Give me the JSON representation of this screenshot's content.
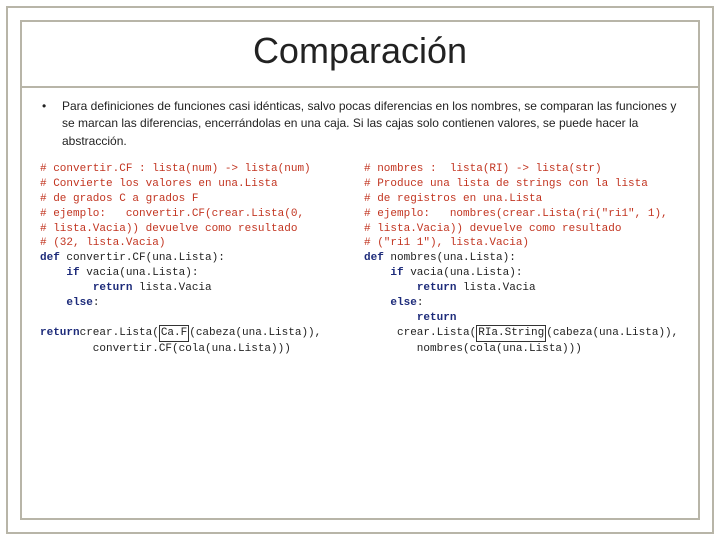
{
  "title": "Comparación",
  "bullet": "•",
  "paragraph": "Para definiciones de funciones  casi idénticas, salvo pocas diferencias en los nombres, se comparan las funciones y se marcan las diferencias, encerrándolas en una caja. Si las cajas solo contienen valores, se puede hacer la abstracción.",
  "code_left": {
    "c1": "# convertir.CF : lista(num) -> lista(num)",
    "c2": "# Convierte los valores en una.Lista",
    "c3": "# de grados C a grados F",
    "c4": "# ejemplo:   convertir.CF(crear.Lista(0,",
    "c5": "# lista.Vacia)) devuelve como resultado",
    "c6": "# (32, lista.Vacia)",
    "def_kw": "def",
    "def_rest": " convertir.CF(una.Lista):",
    "if_kw": "if",
    "if_rest": " vacia(una.Lista):",
    "ret_kw": "return",
    "ret_rest": " lista.Vacia",
    "else_kw": "else",
    "else_rest": ":",
    "ret2_a": "return",
    "ret2_b": "crear.Lista(",
    "box": "Ca.F",
    "ret2_c": "(cabeza(una.Lista)),",
    "tail": "        convertir.CF(cola(una.Lista)))"
  },
  "code_right": {
    "c1": "# nombres :  lista(RI) -> lista(str)",
    "c2": "# Produce una lista de strings con la lista",
    "c3": "# de registros en una.Lista",
    "c4": "# ejemplo:   nombres(crear.Lista(ri(\"ri1\", 1),",
    "c5": "# lista.Vacia)) devuelve como resultado",
    "c6": "# (\"ri1 1\"), lista.Vacia)",
    "def_kw": "def",
    "def_rest": " nombres(una.Lista):",
    "if_kw": "if",
    "if_rest": " vacia(una.Lista):",
    "ret_kw": "return",
    "ret_rest": " lista.Vacia",
    "else_kw": "else",
    "else_rest": ":",
    "ret2_kw": "return",
    "ret2_b": "     crear.Lista(",
    "box": "RIa.String",
    "ret2_c": "(cabeza(una.Lista)),",
    "tail": "        nombres(cola(una.Lista)))"
  }
}
